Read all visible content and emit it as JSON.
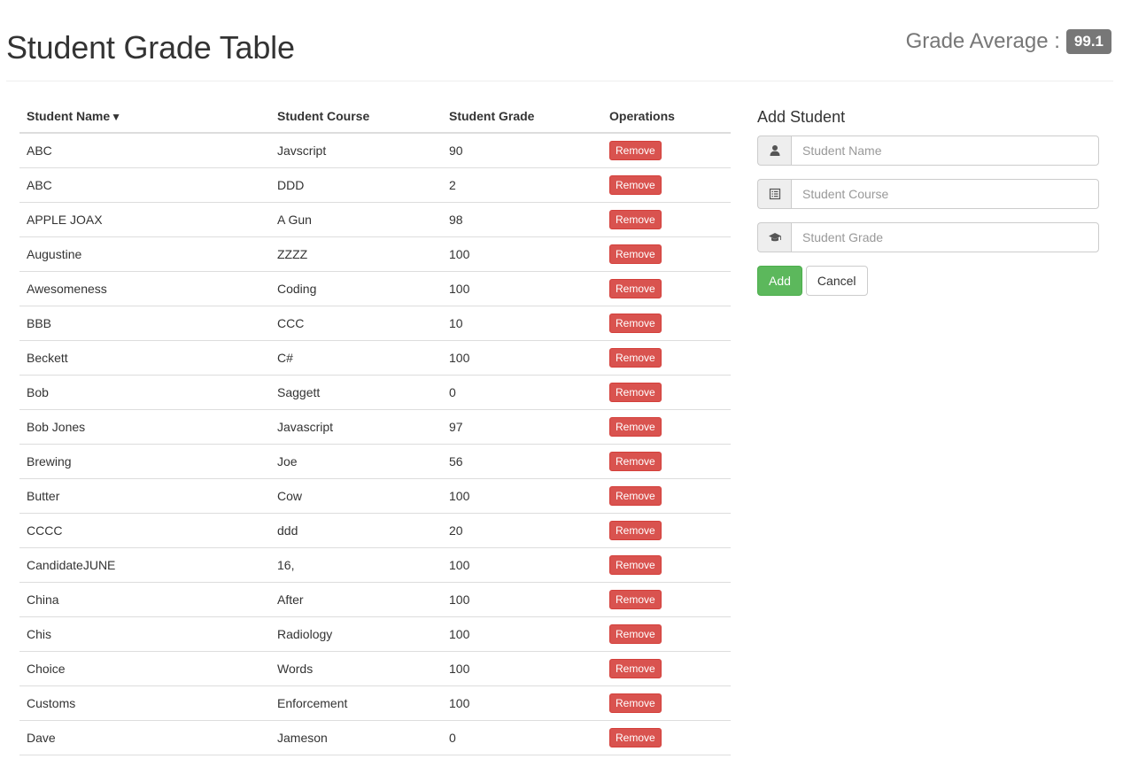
{
  "header": {
    "title": "Student Grade Table",
    "average_label": "Grade Average :",
    "average_value": "99.1"
  },
  "table": {
    "columns": [
      "Student Name",
      "Student Course",
      "Student Grade",
      "Operations"
    ],
    "sort_indicator": "▼",
    "remove_label": "Remove",
    "rows": [
      {
        "name": "ABC",
        "course": "Javscript",
        "grade": "90"
      },
      {
        "name": "ABC",
        "course": "DDD",
        "grade": "2"
      },
      {
        "name": "APPLE JOAX",
        "course": "A Gun",
        "grade": "98"
      },
      {
        "name": "Augustine",
        "course": "ZZZZ",
        "grade": "100"
      },
      {
        "name": "Awesomeness",
        "course": "Coding",
        "grade": "100"
      },
      {
        "name": "BBB",
        "course": "CCC",
        "grade": "10"
      },
      {
        "name": "Beckett",
        "course": "C#",
        "grade": "100"
      },
      {
        "name": "Bob",
        "course": "Saggett",
        "grade": "0"
      },
      {
        "name": "Bob Jones",
        "course": "Javascript",
        "grade": "97"
      },
      {
        "name": "Brewing",
        "course": "Joe",
        "grade": "56"
      },
      {
        "name": "Butter",
        "course": "Cow",
        "grade": "100"
      },
      {
        "name": "CCCC",
        "course": "ddd",
        "grade": "20"
      },
      {
        "name": "CandidateJUNE",
        "course": "16,",
        "grade": "100"
      },
      {
        "name": "China",
        "course": "After",
        "grade": "100"
      },
      {
        "name": "Chis",
        "course": "Radiology",
        "grade": "100"
      },
      {
        "name": "Choice",
        "course": "Words",
        "grade": "100"
      },
      {
        "name": "Customs",
        "course": "Enforcement",
        "grade": "100"
      },
      {
        "name": "Dave",
        "course": "Jameson",
        "grade": "0"
      }
    ]
  },
  "form": {
    "title": "Add Student",
    "fields": [
      {
        "icon": "user-icon",
        "placeholder": "Student Name",
        "value": ""
      },
      {
        "icon": "list-icon",
        "placeholder": "Student Course",
        "value": ""
      },
      {
        "icon": "graduation-cap-icon",
        "placeholder": "Student Grade",
        "value": ""
      }
    ],
    "add_label": "Add",
    "cancel_label": "Cancel"
  },
  "colors": {
    "remove": "#d9534f",
    "add": "#5cb85c",
    "badge": "#777777"
  }
}
